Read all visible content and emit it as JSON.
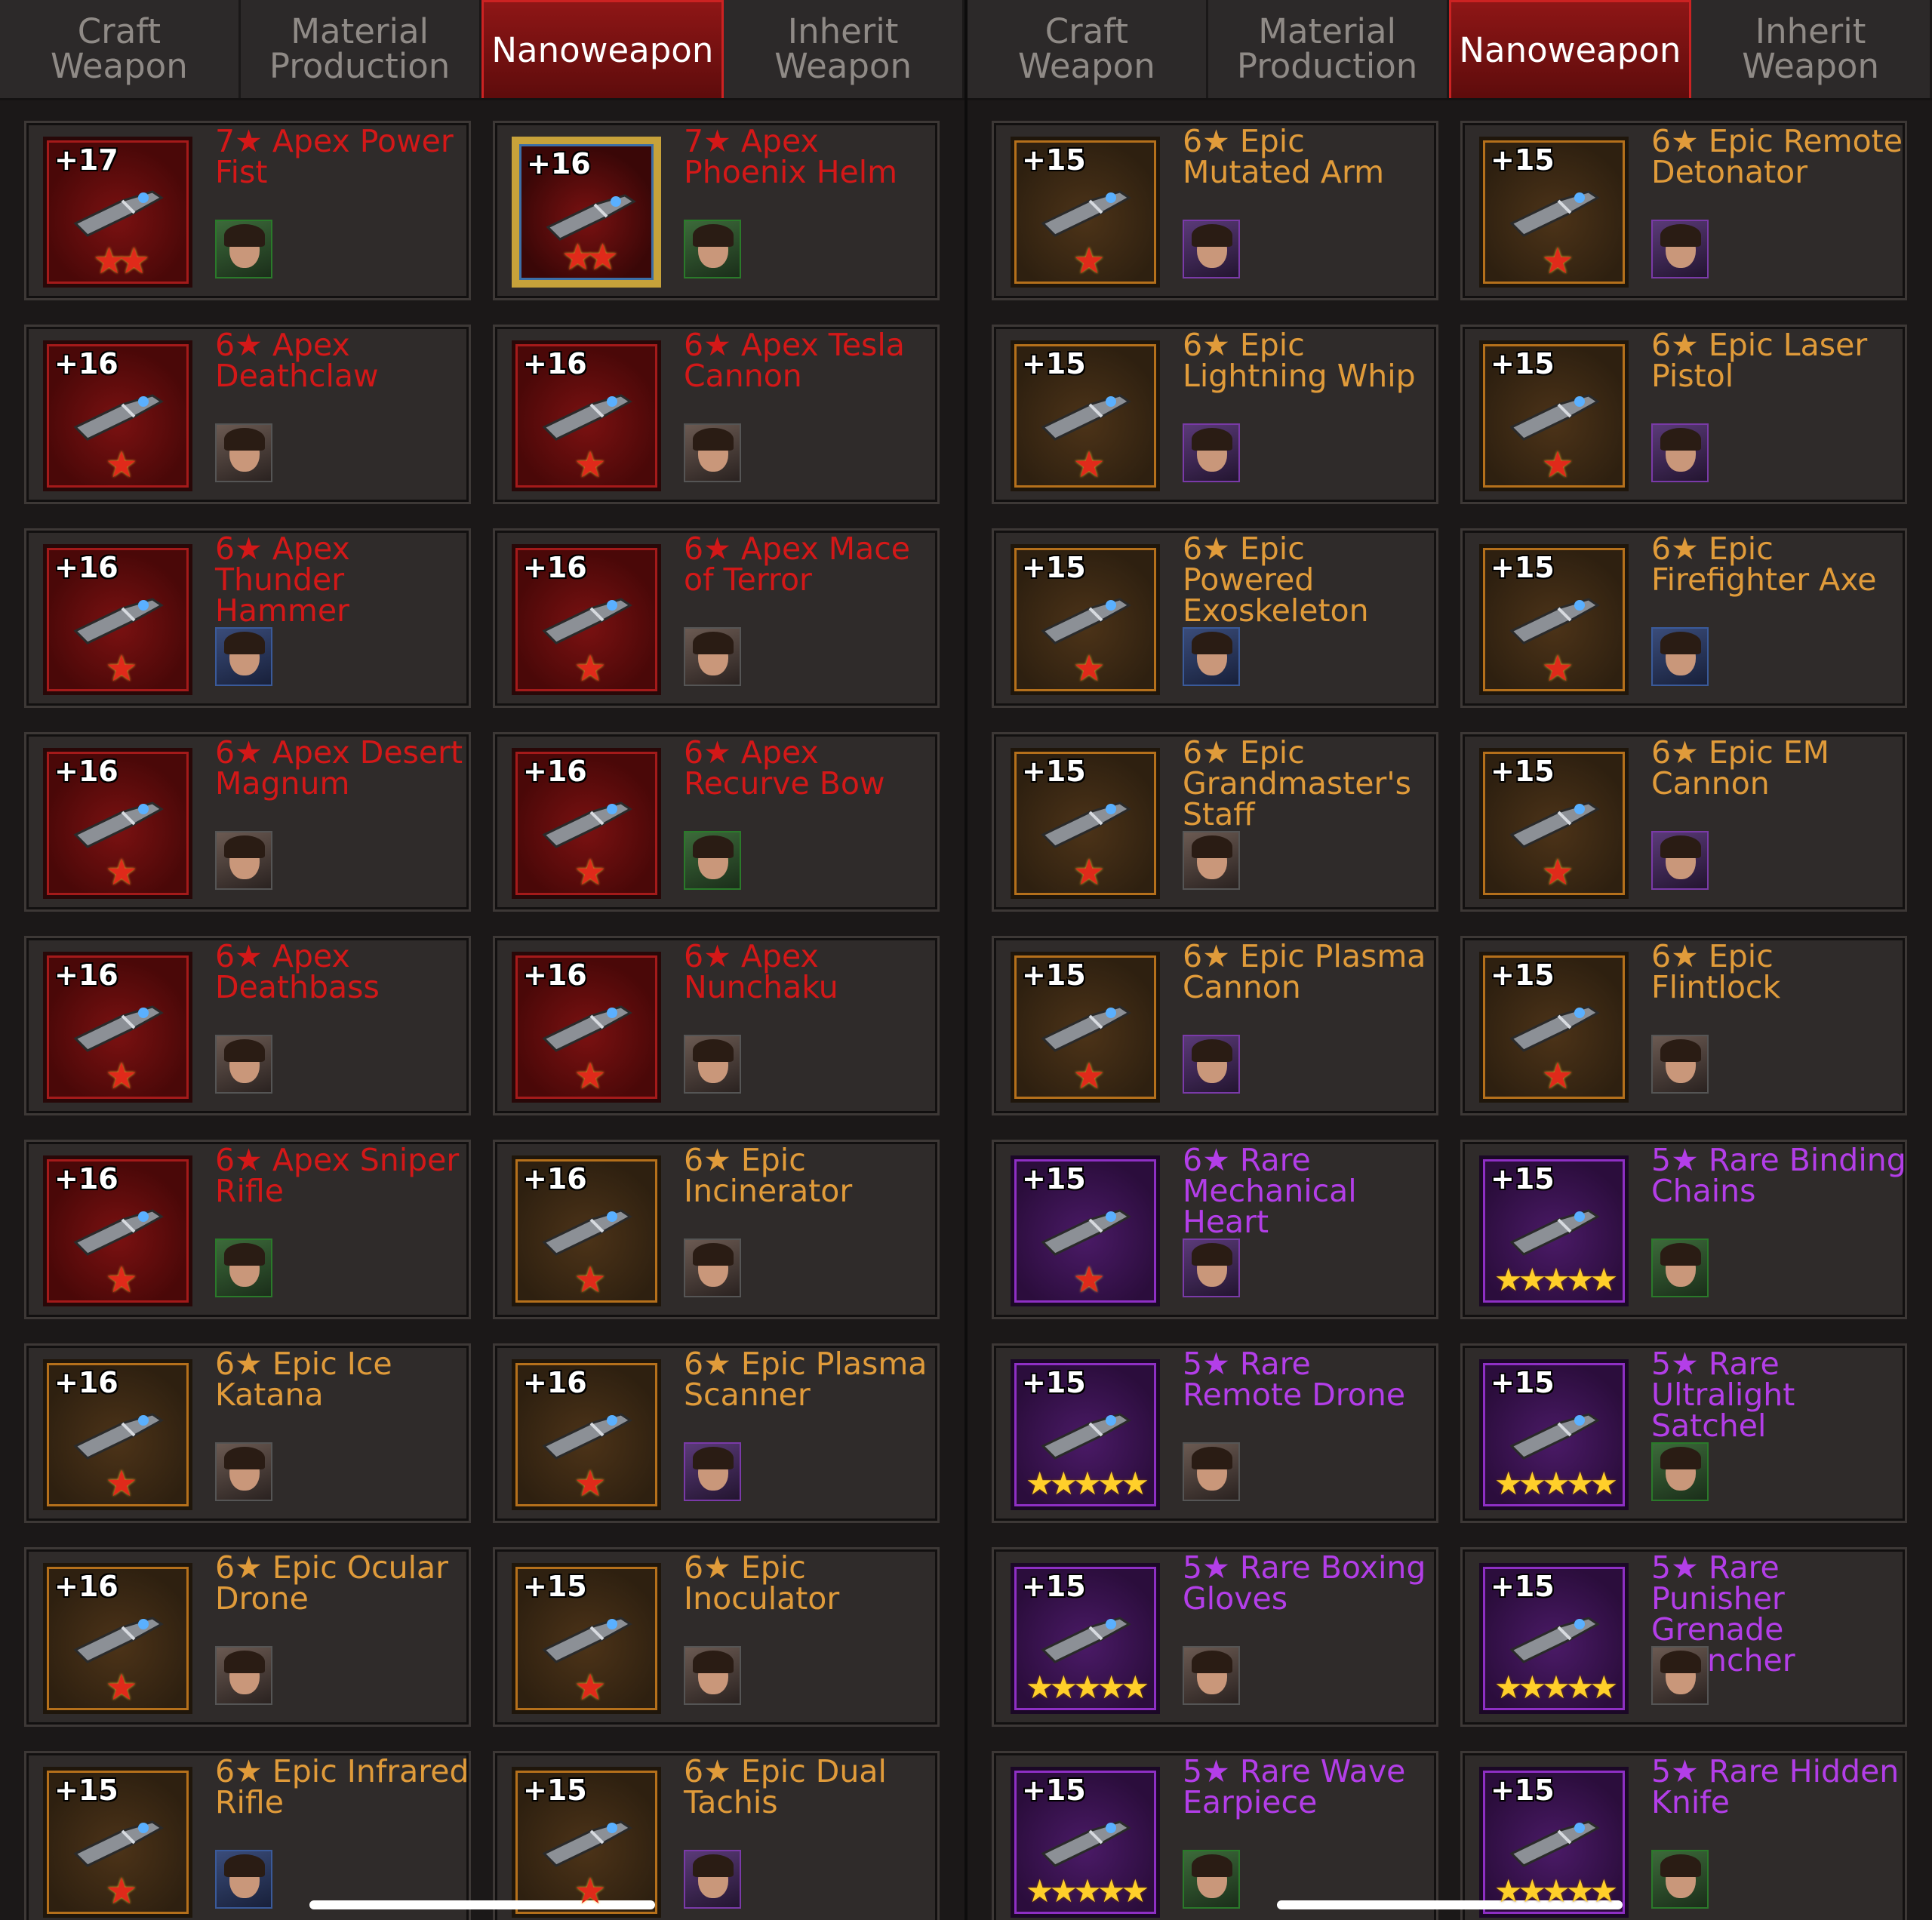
{
  "left_panel": {
    "tabs": [
      {
        "label": "Craft Weapon",
        "active": false
      },
      {
        "label": "Material Production",
        "active": false
      },
      {
        "label": "Nanoweapon",
        "active": true
      },
      {
        "label": "Inherit Weapon",
        "active": false
      }
    ],
    "cards": [
      {
        "level": "+17",
        "name": "7★ Apex Power Fist",
        "rarity": "apex",
        "frame": "red",
        "stars": "★★",
        "weapon_icon": "power-fist-icon",
        "hero_bg": "green"
      },
      {
        "level": "+16",
        "name": "7★ Apex Phoenix Helm",
        "rarity": "apex",
        "frame": "gold",
        "stars": "★★",
        "weapon_icon": "helmet-icon",
        "hero_bg": "green"
      },
      {
        "level": "+16",
        "name": "6★ Apex Deathclaw",
        "rarity": "apex",
        "frame": "red",
        "stars": "★",
        "weapon_icon": "claw-icon",
        "hero_bg": "default"
      },
      {
        "level": "+16",
        "name": "6★ Apex Tesla Cannon",
        "rarity": "apex",
        "frame": "red",
        "stars": "★",
        "weapon_icon": "cannon-icon",
        "hero_bg": "default"
      },
      {
        "level": "+16",
        "name": "6★ Apex Thunder Hammer",
        "rarity": "apex",
        "frame": "red",
        "stars": "★",
        "weapon_icon": "hammer-icon",
        "hero_bg": "blue"
      },
      {
        "level": "+16",
        "name": "6★ Apex Mace of Terror",
        "rarity": "apex",
        "frame": "red",
        "stars": "★",
        "weapon_icon": "mace-icon",
        "hero_bg": "default"
      },
      {
        "level": "+16",
        "name": "6★ Apex Desert Magnum",
        "rarity": "apex",
        "frame": "red",
        "stars": "★",
        "weapon_icon": "revolver-icon",
        "hero_bg": "default"
      },
      {
        "level": "+16",
        "name": "6★ Apex Recurve Bow",
        "rarity": "apex",
        "frame": "red",
        "stars": "★",
        "weapon_icon": "bow-icon",
        "hero_bg": "green"
      },
      {
        "level": "+16",
        "name": "6★ Apex Deathbass",
        "rarity": "apex",
        "frame": "red",
        "stars": "★",
        "weapon_icon": "guitar-icon",
        "hero_bg": "default"
      },
      {
        "level": "+16",
        "name": "6★ Apex Nunchaku",
        "rarity": "apex",
        "frame": "red",
        "stars": "★",
        "weapon_icon": "nunchaku-icon",
        "hero_bg": "default"
      },
      {
        "level": "+16",
        "name": "6★ Apex Sniper Rifle",
        "rarity": "apex",
        "frame": "red",
        "stars": "★",
        "weapon_icon": "sniper-rifle-icon",
        "hero_bg": "green"
      },
      {
        "level": "+16",
        "name": "6★ Epic Incinerator",
        "rarity": "epic",
        "frame": "orange",
        "stars": "★",
        "weapon_icon": "flamethrower-icon",
        "hero_bg": "default"
      },
      {
        "level": "+16",
        "name": "6★ Epic Ice Katana",
        "rarity": "epic",
        "frame": "orange",
        "stars": "★",
        "weapon_icon": "katana-icon",
        "hero_bg": "default"
      },
      {
        "level": "+16",
        "name": "6★ Epic Plasma Scanner",
        "rarity": "epic",
        "frame": "orange",
        "stars": "★",
        "weapon_icon": "scanner-icon",
        "hero_bg": "purple"
      },
      {
        "level": "+16",
        "name": "6★ Epic Ocular Drone",
        "rarity": "epic",
        "frame": "orange",
        "stars": "★",
        "weapon_icon": "drone-icon",
        "hero_bg": "default"
      },
      {
        "level": "+15",
        "name": "6★ Epic Inoculator",
        "rarity": "epic",
        "frame": "orange",
        "stars": "★",
        "weapon_icon": "syringe-gun-icon",
        "hero_bg": "default"
      },
      {
        "level": "+15",
        "name": "6★ Epic Infrared Rifle",
        "rarity": "epic",
        "frame": "orange",
        "stars": "★",
        "weapon_icon": "rifle-icon",
        "hero_bg": "blue"
      },
      {
        "level": "+15",
        "name": "6★ Epic Dual Tachis",
        "rarity": "epic",
        "frame": "orange",
        "stars": "★",
        "weapon_icon": "dual-swords-icon",
        "hero_bg": "purple"
      }
    ]
  },
  "right_panel": {
    "tabs": [
      {
        "label": "Craft Weapon",
        "active": false
      },
      {
        "label": "Material Production",
        "active": false
      },
      {
        "label": "Nanoweapon",
        "active": true
      },
      {
        "label": "Inherit Weapon",
        "active": false
      }
    ],
    "cards": [
      {
        "level": "+15",
        "name": "6★ Epic Mutated Arm",
        "rarity": "epic",
        "frame": "orange",
        "stars": "★",
        "weapon_icon": "mutated-arm-icon",
        "hero_bg": "purple"
      },
      {
        "level": "+15",
        "name": "6★ Epic Remote Detonator",
        "rarity": "epic",
        "frame": "orange",
        "stars": "★",
        "weapon_icon": "detonator-icon",
        "hero_bg": "purple"
      },
      {
        "level": "+15",
        "name": "6★ Epic Lightning Whip",
        "rarity": "epic",
        "frame": "orange",
        "stars": "★",
        "weapon_icon": "whip-icon",
        "hero_bg": "purple"
      },
      {
        "level": "+15",
        "name": "6★ Epic Laser Pistol",
        "rarity": "epic",
        "frame": "orange",
        "stars": "★",
        "weapon_icon": "laser-pistol-icon",
        "hero_bg": "purple"
      },
      {
        "level": "+15",
        "name": "6★ Epic Powered Exoskeleton",
        "rarity": "epic",
        "frame": "orange",
        "stars": "★",
        "weapon_icon": "exoskeleton-icon",
        "hero_bg": "blue"
      },
      {
        "level": "+15",
        "name": "6★ Epic Firefighter Axe",
        "rarity": "epic",
        "frame": "orange",
        "stars": "★",
        "weapon_icon": "axe-icon",
        "hero_bg": "blue"
      },
      {
        "level": "+15",
        "name": "6★ Epic Grandmaster's Staff",
        "rarity": "epic",
        "frame": "orange",
        "stars": "★",
        "weapon_icon": "staff-icon",
        "hero_bg": "default"
      },
      {
        "level": "+15",
        "name": "6★ Epic EM Cannon",
        "rarity": "epic",
        "frame": "orange",
        "stars": "★",
        "weapon_icon": "em-cannon-icon",
        "hero_bg": "purple"
      },
      {
        "level": "+15",
        "name": "6★ Epic Plasma Cannon",
        "rarity": "epic",
        "frame": "orange",
        "stars": "★",
        "weapon_icon": "plasma-cannon-icon",
        "hero_bg": "purple"
      },
      {
        "level": "+15",
        "name": "6★ Epic Flintlock",
        "rarity": "epic",
        "frame": "orange",
        "stars": "★",
        "weapon_icon": "flintlock-icon",
        "hero_bg": "default"
      },
      {
        "level": "+15",
        "name": "6★ Rare Mechanical Heart",
        "rarity": "rare",
        "frame": "purple",
        "stars": "★",
        "weapon_icon": "mechanical-heart-icon",
        "hero_bg": "purple"
      },
      {
        "level": "+15",
        "name": "5★ Rare Binding Chains",
        "rarity": "rare",
        "frame": "purple",
        "stars": "★★★★★",
        "weapon_icon": "chains-icon",
        "hero_bg": "green"
      },
      {
        "level": "+15",
        "name": "5★ Rare Remote Drone",
        "rarity": "rare",
        "frame": "purple",
        "stars": "★★★★★",
        "weapon_icon": "remote-drone-icon",
        "hero_bg": "default"
      },
      {
        "level": "+15",
        "name": "5★ Rare Ultralight Satchel",
        "rarity": "rare",
        "frame": "purple",
        "stars": "★★★★★",
        "weapon_icon": "satchel-icon",
        "hero_bg": "green"
      },
      {
        "level": "+15",
        "name": "5★ Rare Boxing Gloves",
        "rarity": "rare",
        "frame": "purple",
        "stars": "★★★★★",
        "weapon_icon": "boxing-gloves-icon",
        "hero_bg": "default"
      },
      {
        "level": "+15",
        "name": "5★ Rare Punisher Grenade Launcher",
        "rarity": "rare",
        "frame": "purple",
        "stars": "★★★★★",
        "weapon_icon": "grenade-launcher-icon",
        "hero_bg": "default"
      },
      {
        "level": "+15",
        "name": "5★ Rare Wave Earpiece",
        "rarity": "rare",
        "frame": "purple",
        "stars": "★★★★★",
        "weapon_icon": "headset-icon",
        "hero_bg": "green"
      },
      {
        "level": "+15",
        "name": "5★ Rare Hidden Knife",
        "rarity": "rare",
        "frame": "purple",
        "stars": "★★★★★",
        "weapon_icon": "knife-icon",
        "hero_bg": "green"
      }
    ]
  }
}
